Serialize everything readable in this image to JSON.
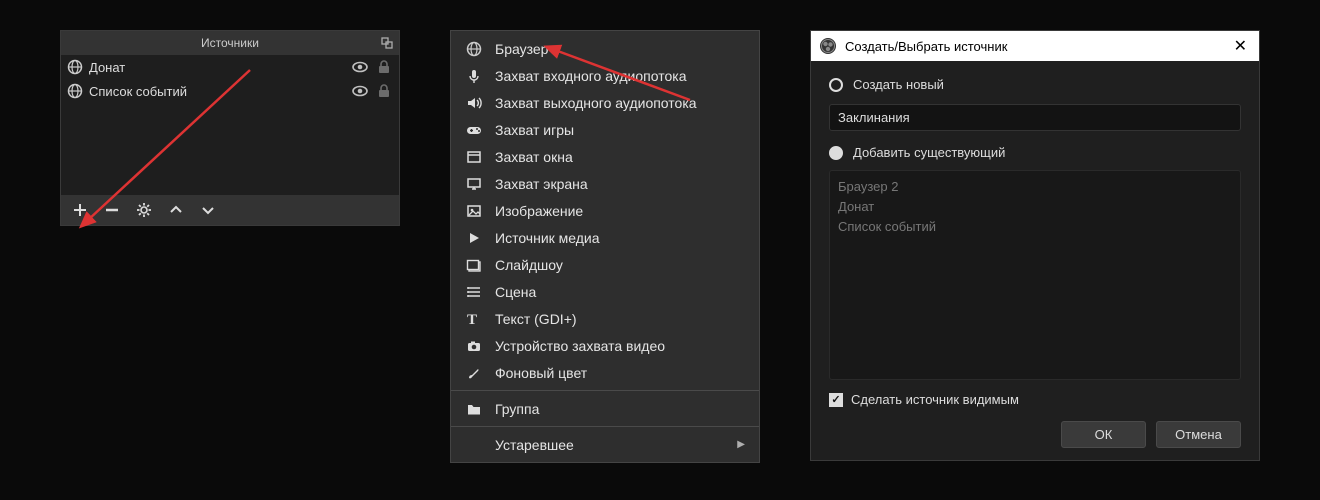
{
  "sources_panel": {
    "title": "Источники",
    "items": [
      {
        "icon": "globe",
        "label": "Донат"
      },
      {
        "icon": "globe",
        "label": "Список событий"
      }
    ]
  },
  "context_menu": {
    "items": [
      {
        "icon": "globe",
        "label": "Браузер"
      },
      {
        "icon": "mic",
        "label": "Захват входного аудиопотока"
      },
      {
        "icon": "speaker",
        "label": "Захват выходного аудиопотока"
      },
      {
        "icon": "gamepad",
        "label": "Захват игры"
      },
      {
        "icon": "window",
        "label": "Захват окна"
      },
      {
        "icon": "monitor",
        "label": "Захват экрана"
      },
      {
        "icon": "image",
        "label": "Изображение"
      },
      {
        "icon": "play",
        "label": "Источник медиа"
      },
      {
        "icon": "slides",
        "label": "Слайдшоу"
      },
      {
        "icon": "list",
        "label": "Сцена"
      },
      {
        "icon": "text",
        "label": "Текст (GDI+)"
      },
      {
        "icon": "camera",
        "label": "Устройство захвата видео"
      },
      {
        "icon": "brush",
        "label": "Фоновый цвет"
      }
    ],
    "group_label": "Группа",
    "deprecated_label": "Устаревшее"
  },
  "dialog": {
    "title": "Создать/Выбрать источник",
    "create_new_label": "Создать новый",
    "name_value": "Заклинания",
    "add_existing_label": "Добавить существующий",
    "existing": [
      "Браузер 2",
      "Донат",
      "Список событий"
    ],
    "visible_label": "Сделать источник видимым",
    "ok": "ОК",
    "cancel": "Отмена"
  }
}
